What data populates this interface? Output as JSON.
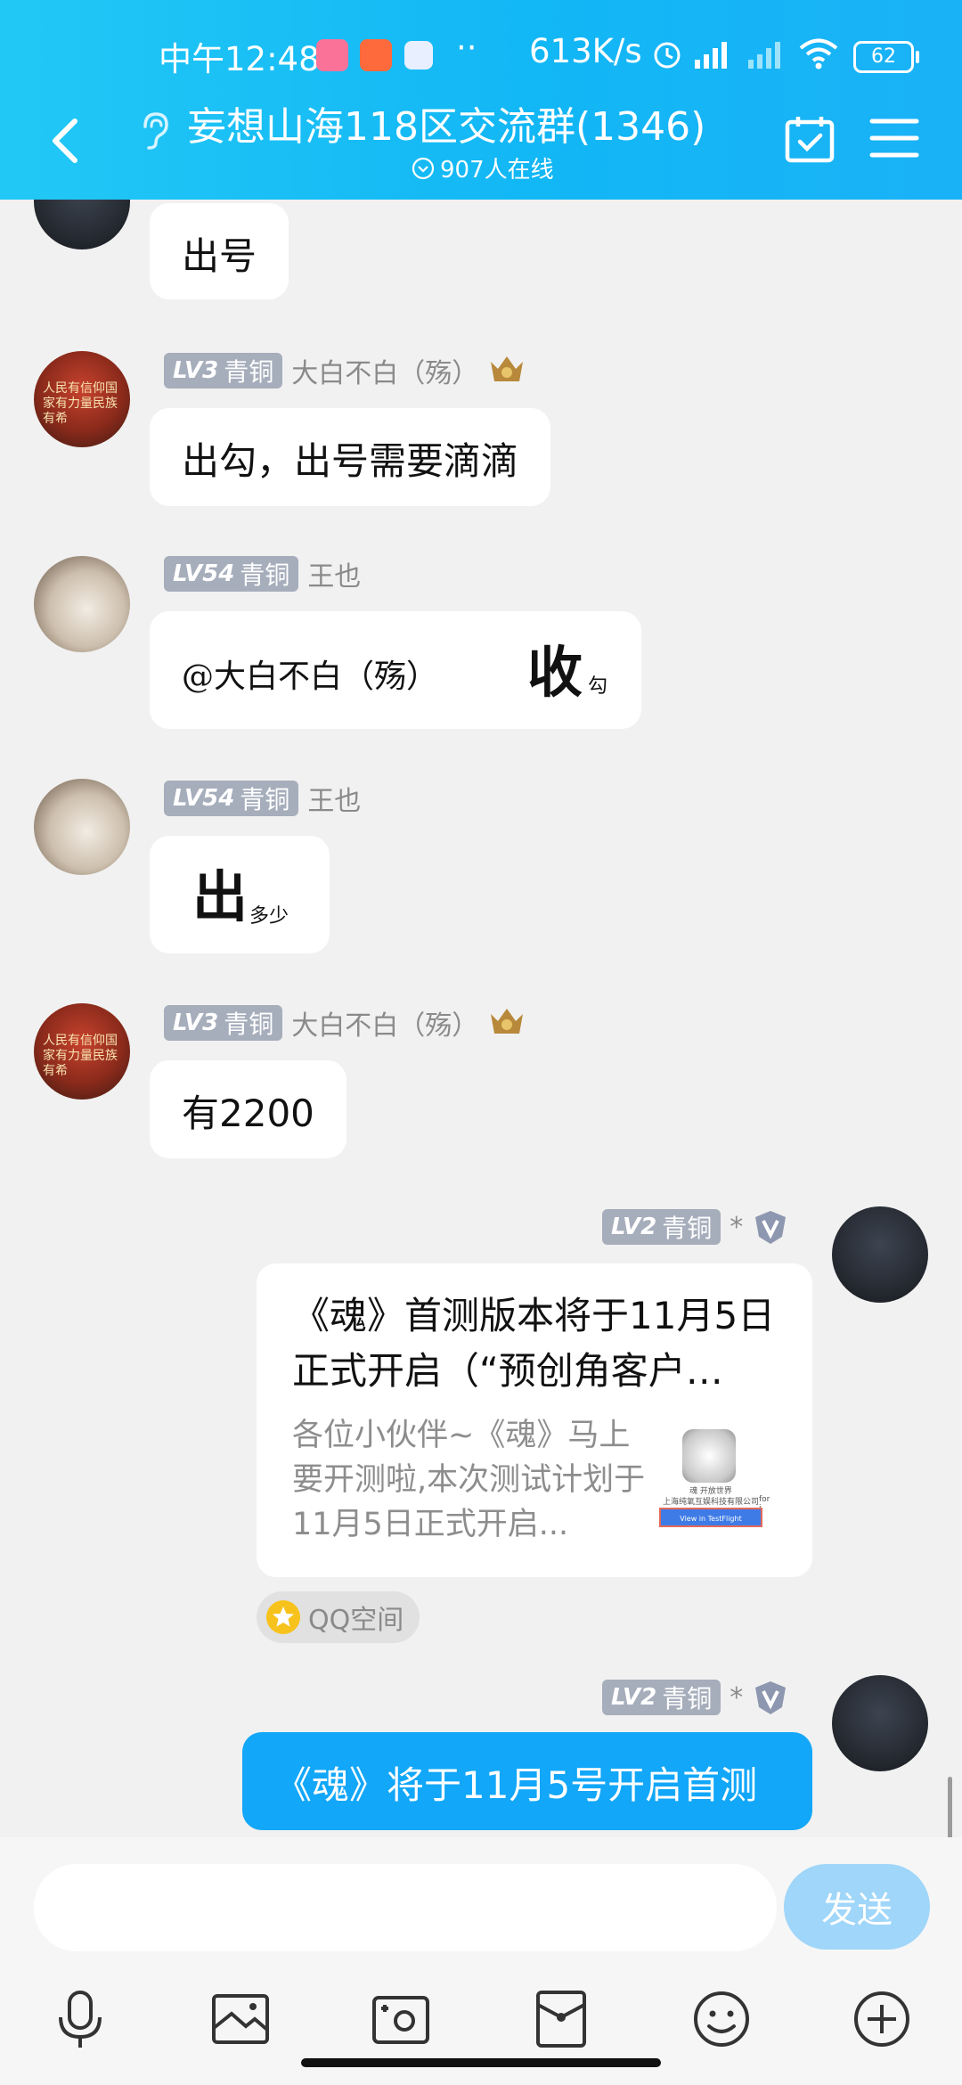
{
  "status_bar": {
    "time": "中午12:48",
    "network_speed": "613K/s",
    "battery": "62",
    "more": "··"
  },
  "header": {
    "title": "妄想山海118区交流群(1346)",
    "online": "907人在线"
  },
  "messages": [
    {
      "text": "出号"
    },
    {
      "level": "LV3",
      "rank": "青铜",
      "sender": "大白不白（殇）",
      "text": "出勾，出号需要滴滴"
    },
    {
      "level": "LV54",
      "rank": "青铜",
      "sender": "王也",
      "mention": "@大白不白（殇）",
      "big": "收",
      "small": "勾"
    },
    {
      "level": "LV54",
      "rank": "青铜",
      "sender": "王也",
      "big": "出",
      "small": "多少"
    },
    {
      "level": "LV3",
      "rank": "青铜",
      "sender": "大白不白（殇）",
      "text": "有2200"
    },
    {
      "level": "LV2",
      "rank": "青铜",
      "sender_mask": "*",
      "card_title": "《魂》首测版本将于11月5日正式开启（“预创角客户…",
      "card_desc": "各位小伙伴~《魂》马上要开测啦,本次测试计划于11月5日正式开启...",
      "source": "QQ空间",
      "thumb_caption": "魂 开放世界",
      "thumb_company": "上海纯氧互娱科技有限公司",
      "thumb_button": "View in TestFlight",
      "thumb_for": "for i"
    },
    {
      "level": "LV2",
      "rank": "青铜",
      "sender_mask": "*",
      "text": "《魂》将于11月5号开启首测"
    }
  ],
  "avatar_text": "人民有信仰国家有力量民族有希",
  "composer": {
    "placeholder": "",
    "send_label": "发送"
  },
  "colors": {
    "header": "#12b7f5",
    "self_bubble": "#12a7f8",
    "send_button": "#9fd6f9",
    "level_badge": "#a6adbb"
  }
}
